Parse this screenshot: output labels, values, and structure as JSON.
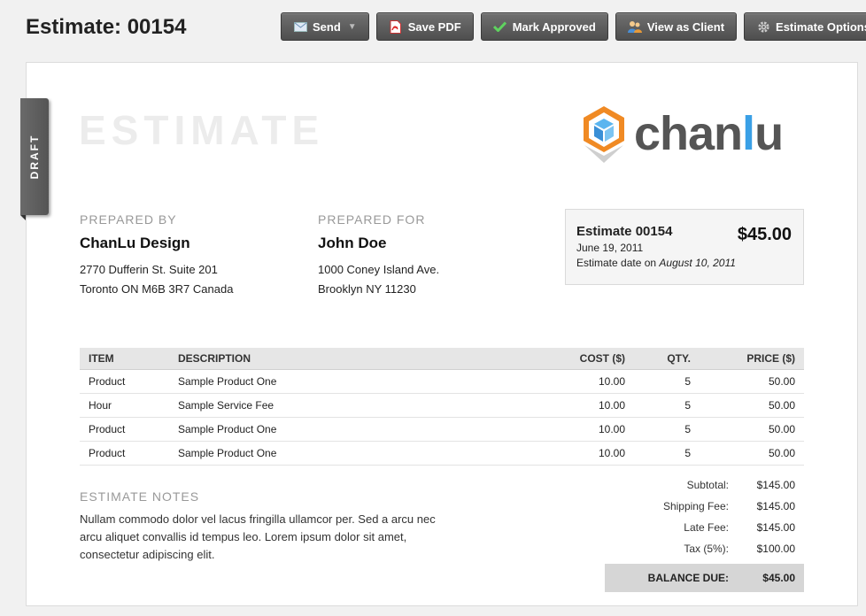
{
  "header": {
    "title": "Estimate: 00154"
  },
  "toolbar": {
    "send": "Send",
    "save_pdf": "Save PDF",
    "mark_approved": "Mark Approved",
    "view_as_client": "View as Client",
    "estimate_options": "Estimate Options"
  },
  "document": {
    "draft_label": "DRAFT",
    "heading": "ESTIMATE",
    "logo": {
      "text_main": "chan",
      "text_accent": "l",
      "text_tail": "u"
    },
    "prepared_by": {
      "label": "PREPARED BY",
      "name": "ChanLu Design",
      "line1": "2770 Dufferin St. Suite 201",
      "line2": "Toronto ON M6B 3R7 Canada"
    },
    "prepared_for": {
      "label": "PREPARED FOR",
      "name": "John Doe",
      "line1": "1000 Coney Island Ave.",
      "line2": "Brooklyn NY 11230"
    },
    "summary": {
      "number": "Estimate 00154",
      "amount": "$45.00",
      "date": "June 19, 2011",
      "estimate_date_label": "Estimate date on",
      "estimate_date": "August 10, 2011"
    },
    "table": {
      "headers": [
        "ITEM",
        "DESCRIPTION",
        "COST ($)",
        "QTY.",
        "PRICE ($)"
      ],
      "rows": [
        {
          "item": "Product",
          "description": "Sample Product One",
          "cost": "10.00",
          "qty": "5",
          "price": "50.00"
        },
        {
          "item": "Hour",
          "description": "Sample Service Fee",
          "cost": "10.00",
          "qty": "5",
          "price": "50.00"
        },
        {
          "item": "Product",
          "description": "Sample Product One",
          "cost": "10.00",
          "qty": "5",
          "price": "50.00"
        },
        {
          "item": "Product",
          "description": "Sample Product One",
          "cost": "10.00",
          "qty": "5",
          "price": "50.00"
        }
      ]
    },
    "notes": {
      "label": "ESTIMATE NOTES",
      "text": "Nullam commodo dolor vel lacus fringilla ullamcor per. Sed a arcu nec arcu aliquet convallis id tempus leo. Lorem ipsum dolor sit amet, consectetur adipiscing elit."
    },
    "totals": {
      "subtotal_label": "Subtotal:",
      "subtotal": "$145.00",
      "shipping_label": "Shipping Fee:",
      "shipping": "$145.00",
      "late_label": "Late Fee:",
      "late": "$145.00",
      "tax_label": "Tax (5%):",
      "tax": "$100.00",
      "balance_label": "BALANCE DUE:",
      "balance": "$45.00"
    }
  },
  "colors": {
    "accent": "#3aa0e6",
    "logo_orange": "#f08a24",
    "button_dark": "#555555"
  }
}
